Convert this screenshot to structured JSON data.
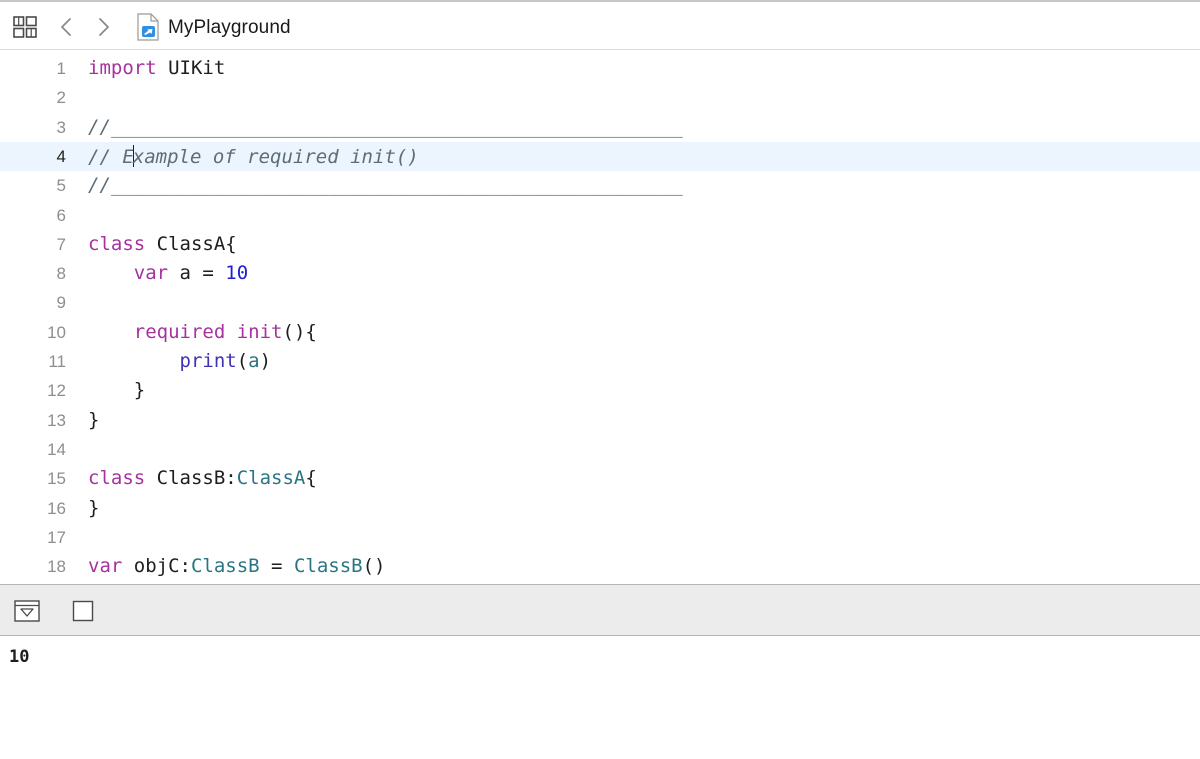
{
  "toolbar": {
    "grid_icon": "grid-icon",
    "back_icon": "chevron-left-icon",
    "forward_icon": "chevron-right-icon",
    "file_icon": "swift-file-icon",
    "title": "MyPlayground"
  },
  "editor": {
    "current_line": 4,
    "lines": [
      {
        "number": "1",
        "text": "import UIKit"
      },
      {
        "number": "2",
        "text": ""
      },
      {
        "number": "3",
        "text": "//__________________________________________________"
      },
      {
        "number": "4",
        "text": "// Example of required init()"
      },
      {
        "number": "5",
        "text": "//__________________________________________________"
      },
      {
        "number": "6",
        "text": ""
      },
      {
        "number": "7",
        "text": "class ClassA{"
      },
      {
        "number": "8",
        "text": "    var a = 10"
      },
      {
        "number": "9",
        "text": ""
      },
      {
        "number": "10",
        "text": "    required init(){"
      },
      {
        "number": "11",
        "text": "        print(a)"
      },
      {
        "number": "12",
        "text": "    }"
      },
      {
        "number": "13",
        "text": "}"
      },
      {
        "number": "14",
        "text": ""
      },
      {
        "number": "15",
        "text": "class ClassB:ClassA{"
      },
      {
        "number": "16",
        "text": "}"
      },
      {
        "number": "17",
        "text": ""
      },
      {
        "number": "18",
        "text": "var objC:ClassB = ClassB()"
      }
    ]
  },
  "console": {
    "toggle_icon": "hide-debug-area-icon",
    "checkbox_icon": "checkbox-icon",
    "output": "10"
  },
  "colors": {
    "keyword": "#a6329e",
    "number": "#1e21d0",
    "type": "#2a7583",
    "function": "#3f32b4",
    "comment": "#5d6c79",
    "current_line_bg": "#ecf5fe",
    "console_bar_bg": "#ececec"
  }
}
